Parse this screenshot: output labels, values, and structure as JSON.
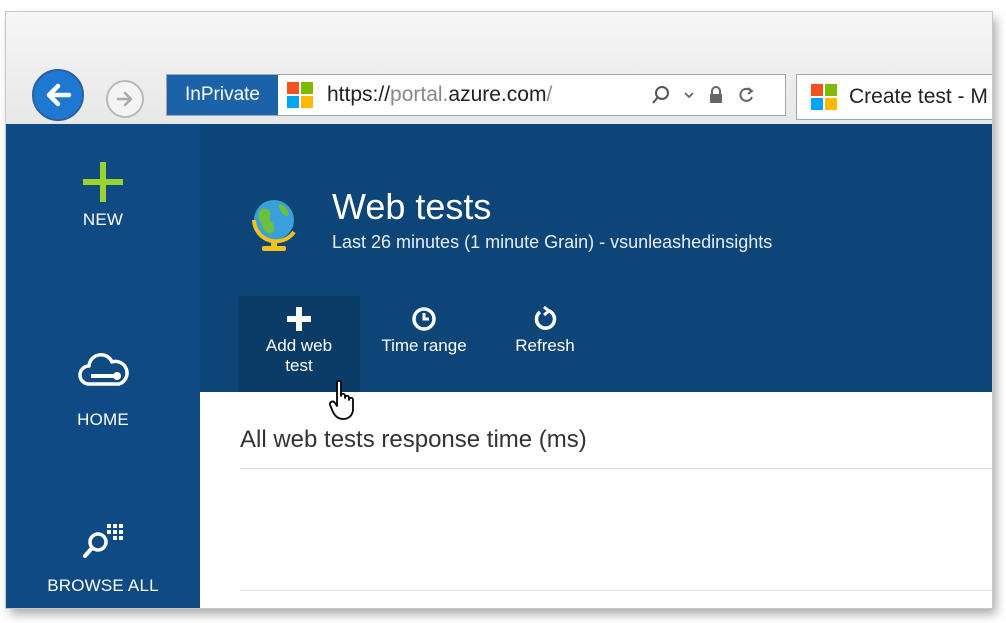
{
  "browser": {
    "inprivate_label": "InPrivate",
    "url_prefix": "https://",
    "url_dim": "portal.",
    "url_domain": "azure.com",
    "url_path": "/",
    "tab_title": "Create test - M"
  },
  "sidebar": {
    "items": [
      {
        "label": "NEW",
        "icon": "plus-icon"
      },
      {
        "label": "HOME",
        "icon": "cloud-icon"
      },
      {
        "label": "BROWSE ALL",
        "icon": "browse-icon"
      }
    ]
  },
  "blade": {
    "title": "Web tests",
    "subtitle": "Last 26 minutes (1 minute Grain) - vsunleashedinsights",
    "icon": "globe-icon",
    "toolbar": [
      {
        "label_line1": "Add web",
        "label_line2": "test",
        "icon": "plus-icon"
      },
      {
        "label_line1": "Time range",
        "icon": "clock-icon"
      },
      {
        "label_line1": "Refresh",
        "icon": "refresh-icon"
      }
    ]
  },
  "content": {
    "chart_title": "All web tests response time (ms)"
  },
  "colors": {
    "sidebar": "#0f4a85",
    "header": "#0d4579",
    "accent_green": "#9bd32f",
    "inprivate": "#1c62a8"
  }
}
